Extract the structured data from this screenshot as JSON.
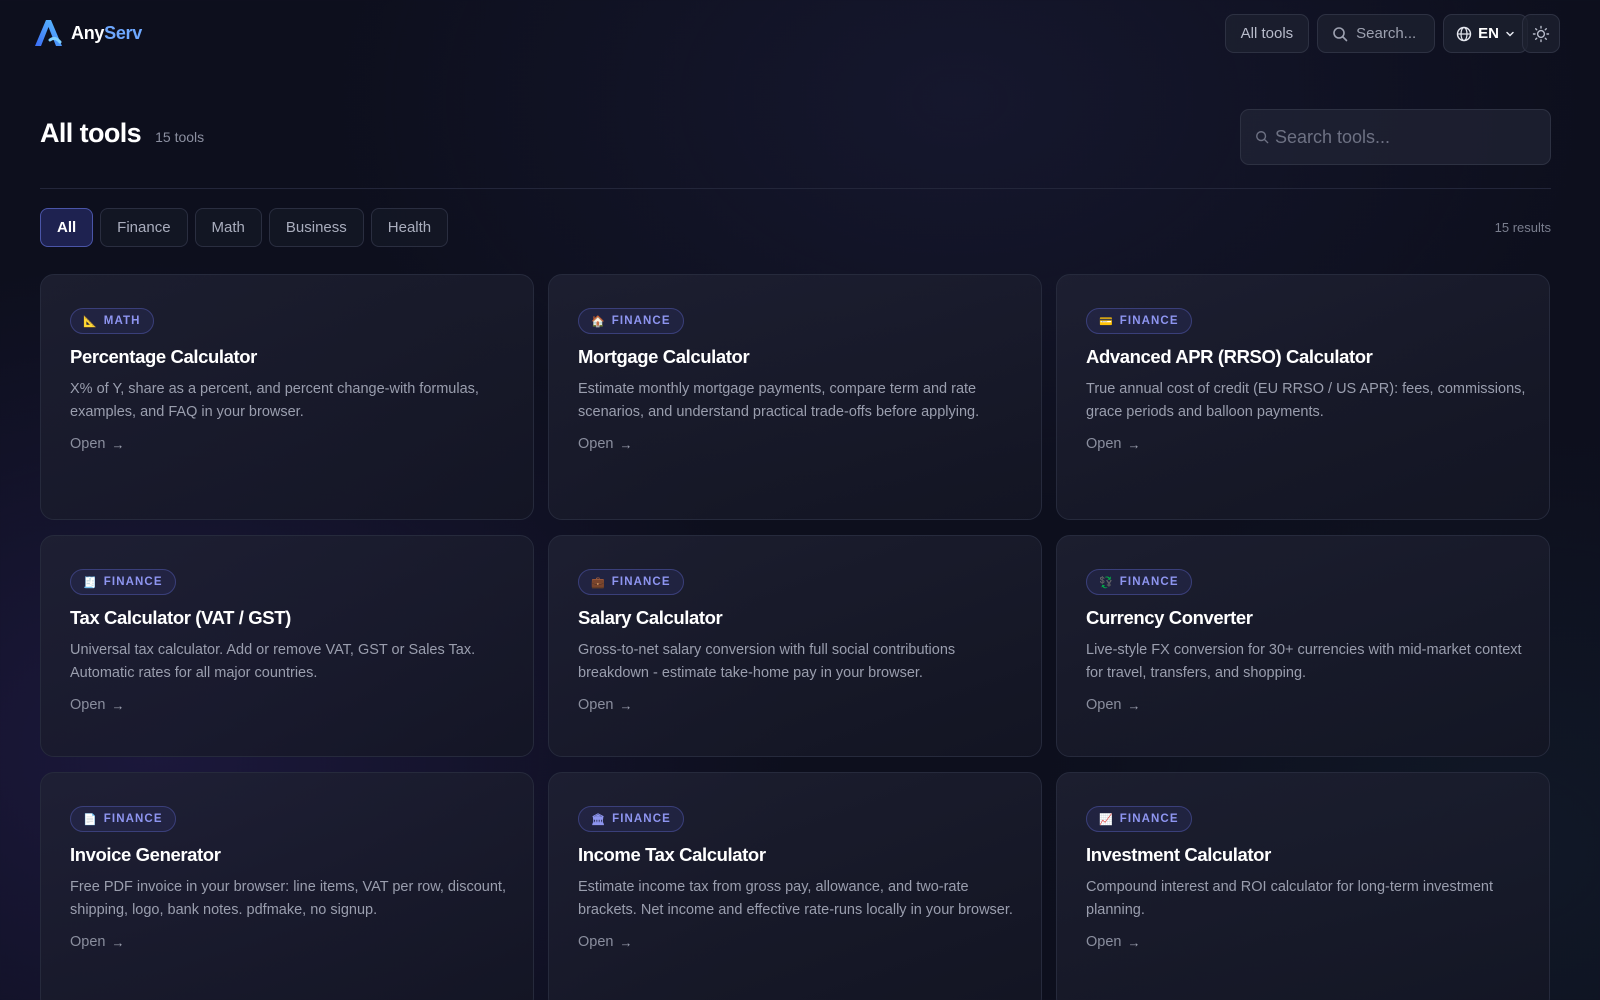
{
  "brand": {
    "name_part1": "Any",
    "name_part2": "Serv"
  },
  "nav": {
    "all_tools": "All tools",
    "search_label": "Search...",
    "lang": "EN"
  },
  "page": {
    "title": "All tools",
    "count": "15 tools",
    "search_placeholder": "Search tools..."
  },
  "filters": [
    {
      "label": "All",
      "active": true
    },
    {
      "label": "Finance"
    },
    {
      "label": "Math"
    },
    {
      "label": "Business"
    },
    {
      "label": "Health"
    }
  ],
  "results": "15 results",
  "cards": [
    {
      "badge_icon": "📐",
      "category": "MATH",
      "title": "Percentage Calculator",
      "desc": "X% of Y, share as a percent, and percent change-with formulas, examples, and FAQ in your browser.",
      "open": "Open"
    },
    {
      "badge_icon": "🏠",
      "category": "FINANCE",
      "title": "Mortgage Calculator",
      "desc": "Estimate monthly mortgage payments, compare term and rate scenarios, and understand practical trade-offs before applying.",
      "open": "Open"
    },
    {
      "badge_icon": "💳",
      "category": "FINANCE",
      "title": "Advanced APR (RRSO) Calculator",
      "desc": "True annual cost of credit (EU RRSO / US APR): fees, commissions, grace periods and balloon payments.",
      "open": "Open"
    },
    {
      "badge_icon": "🧾",
      "category": "FINANCE",
      "title": "Tax Calculator (VAT / GST)",
      "desc": "Universal tax calculator. Add or remove VAT, GST or Sales Tax. Automatic rates for all major countries.",
      "open": "Open"
    },
    {
      "badge_icon": "💼",
      "category": "FINANCE",
      "title": "Salary Calculator",
      "desc": "Gross-to-net salary conversion with full social contributions breakdown - estimate take-home pay in your browser.",
      "open": "Open"
    },
    {
      "badge_icon": "💱",
      "category": "FINANCE",
      "title": "Currency Converter",
      "desc": "Live-style FX conversion for 30+ currencies with mid-market context for travel, transfers, and shopping.",
      "open": "Open"
    },
    {
      "badge_icon": "📄",
      "category": "FINANCE",
      "title": "Invoice Generator",
      "desc": "Free PDF invoice in your browser: line items, VAT per row, discount, shipping, logo, bank notes. pdfmake, no signup.",
      "open": "Open"
    },
    {
      "badge_icon": "🏛",
      "category": "FINANCE",
      "title": "Income Tax Calculator",
      "desc": "Estimate income tax from gross pay, allowance, and two-rate brackets. Net income and effective rate-runs locally in your browser.",
      "open": "Open"
    },
    {
      "badge_icon": "📈",
      "category": "FINANCE",
      "title": "Investment Calculator",
      "desc": "Compound interest and ROI calculator for long-term investment planning.",
      "open": "Open"
    }
  ]
}
